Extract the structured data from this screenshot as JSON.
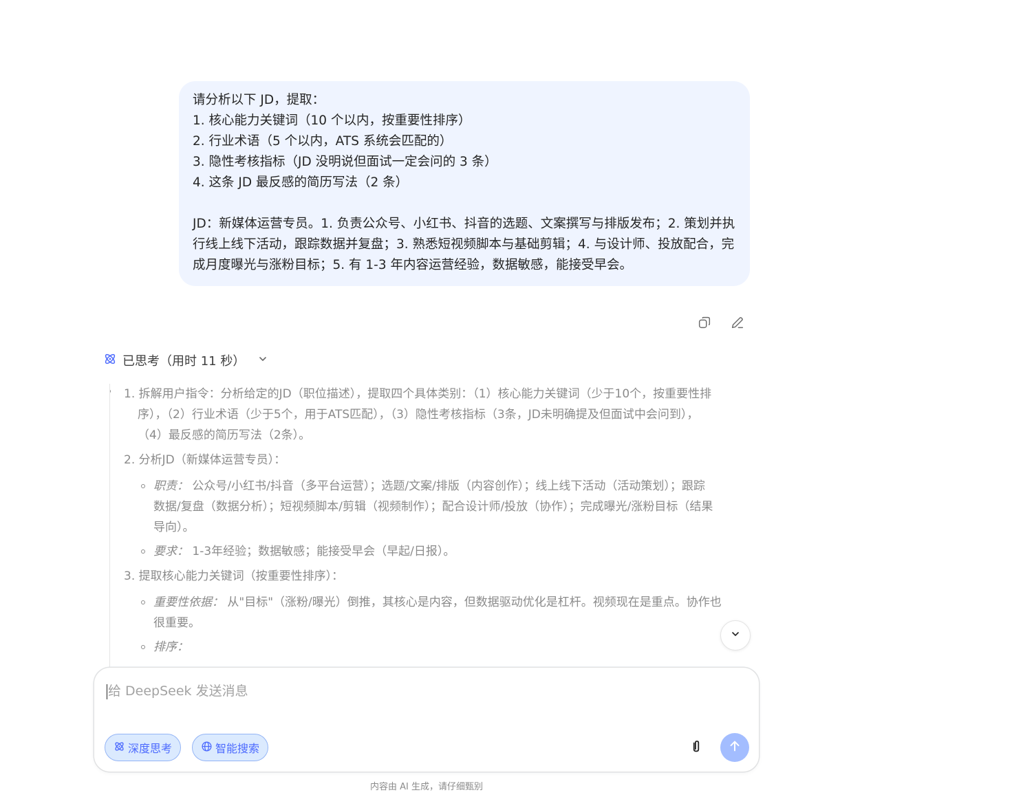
{
  "user_message": {
    "lines": [
      "请分析以下 JD，提取：",
      "1. 核心能力关键词（10 个以内，按重要性排序）",
      "2. 行业术语（5 个以内，ATS 系统会匹配的）",
      "3. 隐性考核指标（JD 没明说但面试一定会问的 3 条）",
      "4. 这条 JD 最反感的简历写法（2 条）"
    ],
    "jd_text": "JD：新媒体运营专员。1. 负责公众号、小红书、抖音的选题、文案撰写与排版发布；2. 策划并执行线上线下活动，跟踪数据并复盘；3. 熟悉短视频脚本与基础剪辑；4. 与设计师、投放配合，完成月度曝光与涨粉目标；5. 有 1-3 年内容运营经验，数据敏感，能接受早会。"
  },
  "message_actions": {
    "copy_icon": "copy-icon",
    "edit_icon": "edit-icon"
  },
  "thinking": {
    "header": "已思考（用时 11 秒）",
    "icon": "deepthink-icon",
    "steps": {
      "s1": {
        "l1": "1. 拆解用户指令：分析给定的JD（职位描述），提取四个具体类别：（1）核心能力关键词（少于10个，按重要性排",
        "l2": "序），（2）行业术语（少于5个，用于ATS匹配），（3）隐性考核指标（3条，JD未明确提及但面试中会问到），",
        "l3": "（4）最反感的简历写法（2条）。"
      },
      "s2": {
        "title": "2. 分析JD（新媒体运营专员）：",
        "duty_label": "职责：",
        "duty_l1": "公众号/小红书/抖音（多平台运营）；选题/文案/排版（内容创作）；线上线下活动（活动策划）；跟踪",
        "duty_l2": "数据/复盘（数据分析）；短视频脚本/剪辑（视频制作）；配合设计师/投放（协作）；完成曝光/涨粉目标（结果",
        "duty_l3": "导向）。",
        "req_label": "要求：",
        "req_text": "1-3年经验；数据敏感；能接受早会（早起/日报）。"
      },
      "s3": {
        "title": "3. 提取核心能力关键词（按重要性排序）：",
        "basis_label": "重要性依据：",
        "basis_l1": "从\"目标\"（涨粉/曝光）倒推，其核心是内容，但数据驱动优化是杠杆。视频现在是重点。协作也",
        "basis_l2": "很重要。",
        "order_label": "排序："
      }
    }
  },
  "composer": {
    "placeholder": "给 DeepSeek 发送消息",
    "deep_think_label": "深度思考",
    "search_label": "智能搜索"
  },
  "footer": {
    "note": "内容由 AI 生成，请仔细甄别"
  },
  "colors": {
    "accent": "#4d6bfe",
    "bubble": "#eff4ff",
    "send_disabled": "#a3bdff"
  }
}
